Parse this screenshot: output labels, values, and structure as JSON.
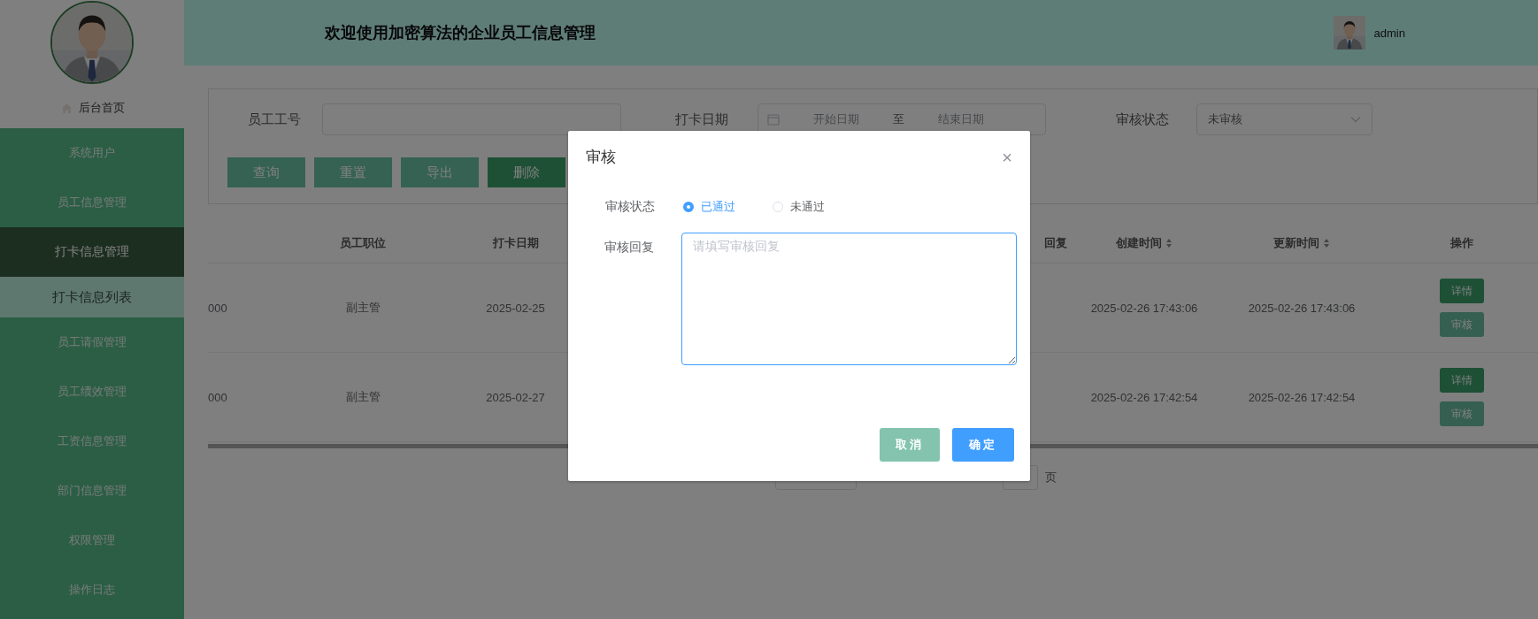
{
  "sidebar": {
    "home": "后台首页",
    "items": [
      {
        "label": "系统用户",
        "selected": false,
        "expanded": false
      },
      {
        "label": "员工信息管理",
        "selected": false,
        "expanded": false
      },
      {
        "label": "打卡信息管理",
        "selected": false,
        "expanded": true,
        "children": [
          {
            "label": "打卡信息列表",
            "selected": true
          }
        ]
      },
      {
        "label": "员工请假管理",
        "selected": false,
        "expanded": false
      },
      {
        "label": "员工绩效管理",
        "selected": false,
        "expanded": false
      },
      {
        "label": "工资信息管理",
        "selected": false,
        "expanded": false
      },
      {
        "label": "部门信息管理",
        "selected": false,
        "expanded": false
      },
      {
        "label": "权限管理",
        "selected": false,
        "expanded": false
      },
      {
        "label": "操作日志",
        "selected": false,
        "expanded": false
      }
    ]
  },
  "header": {
    "title": "欢迎使用加密算法的企业员工信息管理",
    "user": "admin"
  },
  "filters": [
    {
      "kind": "text",
      "label": "员工工号"
    },
    {
      "kind": "daterange",
      "label": "打卡日期",
      "start_placeholder": "开始日期",
      "separator": "至",
      "end_placeholder": "结束日期"
    },
    {
      "kind": "select",
      "label": "审核状态",
      "value": "未审核"
    }
  ],
  "filter_buttons": [
    {
      "label": "查询",
      "kind": "plain"
    },
    {
      "label": "重置",
      "kind": "plain"
    },
    {
      "label": "导出",
      "kind": "plain"
    },
    {
      "label": "删除",
      "kind": "danger"
    }
  ],
  "table": {
    "columns": [
      {
        "kind": "data"
      },
      {
        "kind": "data",
        "label": "员工职位"
      },
      {
        "kind": "data",
        "label": "打卡日期"
      },
      {
        "kind": "hidden",
        "label": "回复"
      },
      {
        "kind": "data",
        "label": "创建时间",
        "sortable": true
      },
      {
        "kind": "data",
        "label": "更新时间",
        "sortable": true
      },
      {
        "kind": "actions",
        "label": "操作"
      }
    ],
    "rows": [
      {
        "cells": [
          "000",
          "副主管",
          "2025-02-25",
          "",
          "2025-02-26 17:43:06",
          "2025-02-26 17:43:06"
        ],
        "actions": [
          {
            "label": "详情",
            "kind": "detail"
          },
          {
            "label": "审核",
            "kind": "review"
          }
        ]
      },
      {
        "cells": [
          "000",
          "副主管",
          "2025-02-27",
          "",
          "2025-02-26 17:42:54",
          "2025-02-26 17:42:54"
        ],
        "actions": [
          {
            "label": "详情",
            "kind": "detail"
          },
          {
            "label": "审核",
            "kind": "review"
          }
        ]
      }
    ]
  },
  "pagination": {
    "page_suffix": "页"
  },
  "dialog": {
    "title": "审核",
    "close": "×",
    "fields": [
      {
        "kind": "radio",
        "label": "审核状态",
        "options": [
          {
            "label": "已通过",
            "selected": true
          },
          {
            "label": "未通过",
            "selected": false
          }
        ]
      },
      {
        "kind": "textarea",
        "label": "审核回复",
        "placeholder": "请填写审核回复"
      }
    ],
    "buttons": [
      {
        "label": "取消",
        "kind": "cancel"
      },
      {
        "label": "确定",
        "kind": "confirm"
      }
    ]
  }
}
